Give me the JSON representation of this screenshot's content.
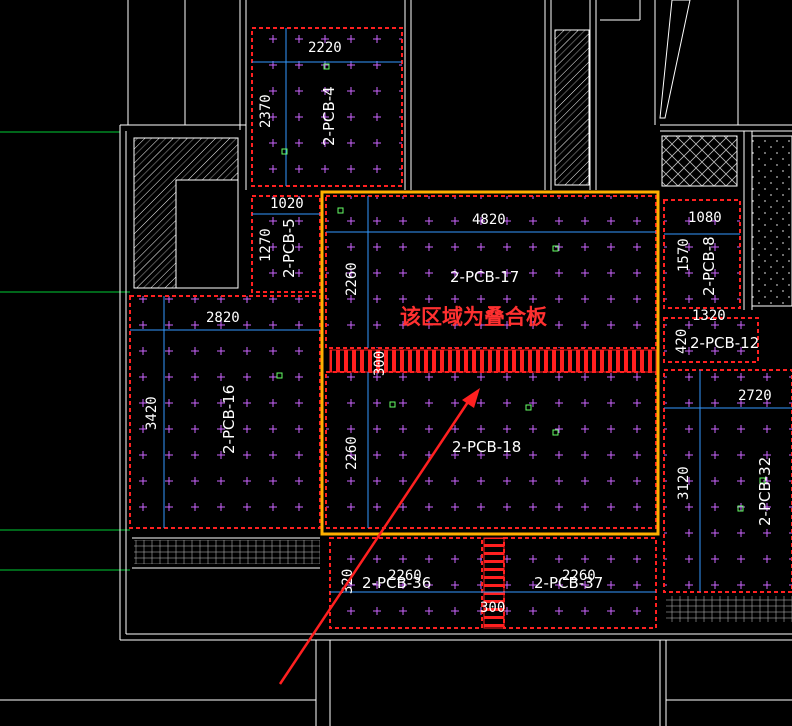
{
  "annotation": {
    "text": "该区域为叠合板",
    "color": "#ff2020",
    "frame_color": "#ffb000"
  },
  "colors": {
    "background": "#000000",
    "wall": "#ffffff",
    "grid": "#00cc33",
    "slab_edge": "#ff2020",
    "plus": "#cc66ff",
    "dim_line": "#3399ff"
  },
  "panels": [
    {
      "label": "2-PCB-4",
      "dims": [
        "2220",
        "2370"
      ]
    },
    {
      "label": "2-PCB-5",
      "dims": [
        "1020",
        "1270"
      ]
    },
    {
      "label": "2-PCB-17",
      "dims": [
        "4820",
        "2260"
      ]
    },
    {
      "label": "2-PCB-16",
      "dims": [
        "2820",
        "3420"
      ]
    },
    {
      "label": "2-PCB-18",
      "dims": [
        "2260"
      ]
    },
    {
      "label": "2-PCB-8",
      "dims": [
        "1080",
        "1570"
      ]
    },
    {
      "label": "2-PCB-12",
      "dims": [
        "1320",
        "420"
      ]
    },
    {
      "label": "2-PCB-32",
      "dims": [
        "2720",
        "3120"
      ]
    },
    {
      "label": "2-PCB-36",
      "dims": [
        "2260",
        "320"
      ]
    },
    {
      "label": "2-PCB-37",
      "dims": [
        "2260"
      ]
    }
  ],
  "joints": [
    "300",
    "300"
  ]
}
